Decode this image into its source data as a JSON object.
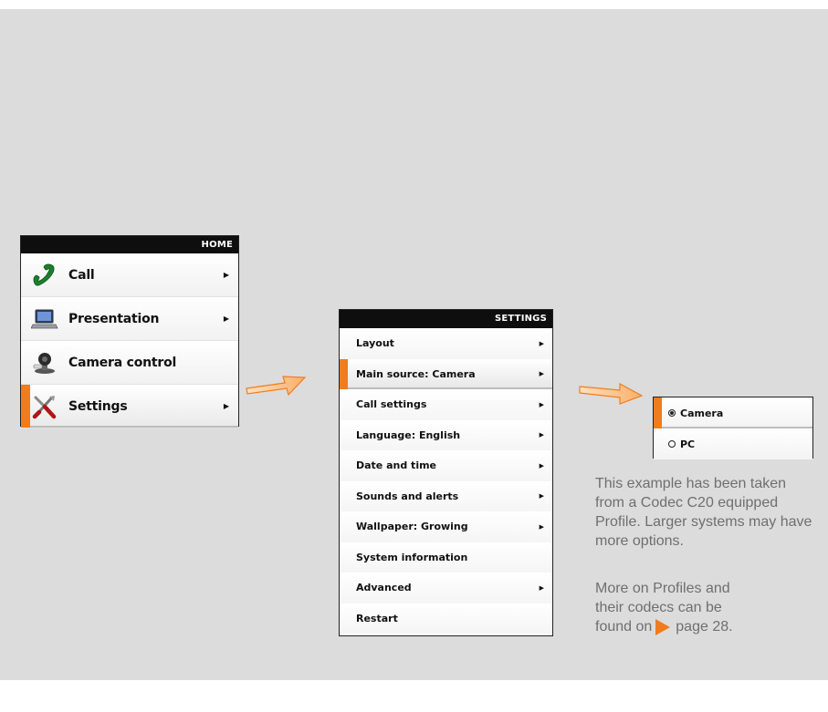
{
  "home_menu": {
    "header": "HOME",
    "items": [
      {
        "label": "Call",
        "icon": "phone-icon",
        "has_submenu": true
      },
      {
        "label": "Presentation",
        "icon": "laptop-icon",
        "has_submenu": true
      },
      {
        "label": "Camera control",
        "icon": "camera-icon",
        "has_submenu": false
      },
      {
        "label": "Settings",
        "icon": "tools-icon",
        "has_submenu": true,
        "selected": true
      }
    ]
  },
  "settings_menu": {
    "header": "SETTINGS",
    "items": [
      {
        "label": "Layout",
        "has_submenu": true
      },
      {
        "label": "Main source: Camera",
        "has_submenu": true,
        "selected": true
      },
      {
        "label": "Call settings",
        "has_submenu": true
      },
      {
        "label": "Language: English",
        "has_submenu": true
      },
      {
        "label": "Date and time",
        "has_submenu": true
      },
      {
        "label": "Sounds and alerts",
        "has_submenu": true
      },
      {
        "label": "Wallpaper: Growing",
        "has_submenu": true
      },
      {
        "label": "System information",
        "has_submenu": false
      },
      {
        "label": "Advanced",
        "has_submenu": true
      },
      {
        "label": "Restart",
        "has_submenu": false
      }
    ]
  },
  "source_menu": {
    "options": [
      {
        "label": "Camera",
        "checked": true
      },
      {
        "label": "PC",
        "checked": false
      }
    ]
  },
  "caption": {
    "paragraph1": "This example has been taken from a Codec C20 equipped Profile. Larger systems may have more options.",
    "paragraph2_line1": "More on Profiles and",
    "paragraph2_line2": "their codecs can be",
    "paragraph2_prefix": "found on",
    "paragraph2_link": "page 28."
  },
  "colors": {
    "accent": "#f07c1d",
    "header_bg": "#0e0e0e",
    "page_bg": "#dcdcdc",
    "caption_text": "#6f6f6f"
  }
}
